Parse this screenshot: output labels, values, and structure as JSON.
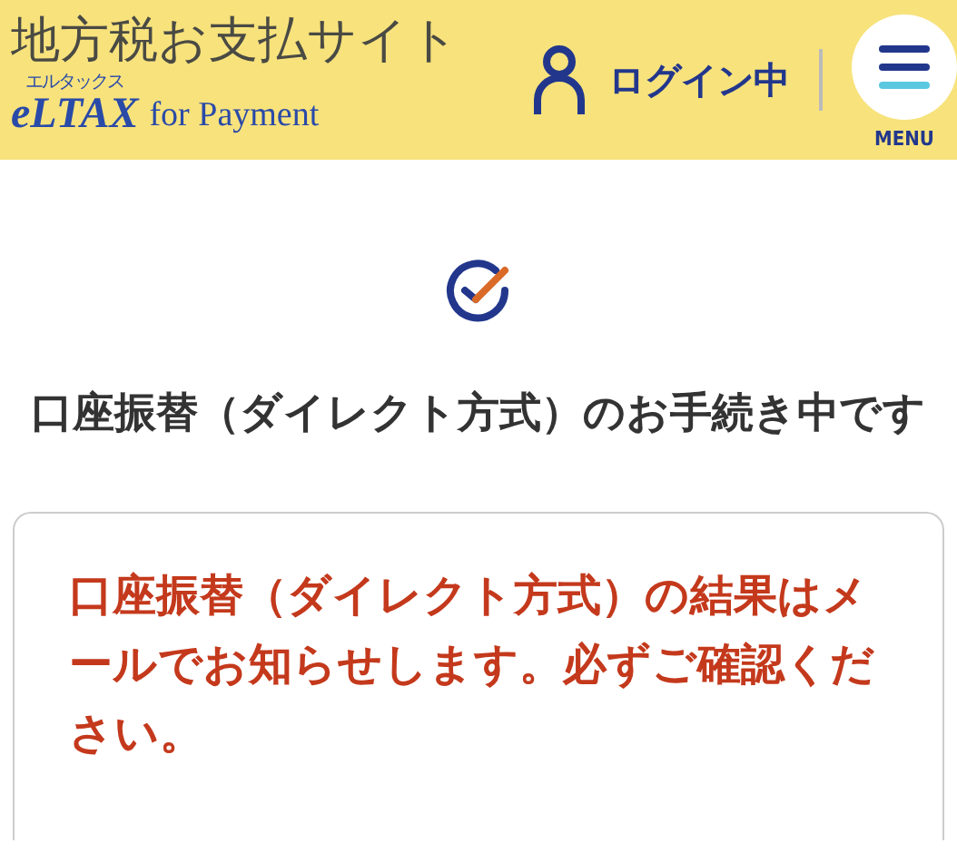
{
  "header": {
    "site_title": "地方税お支払サイト",
    "logo": {
      "ruby": "エルタックス",
      "brand": "eLTAX",
      "tagline": "for Payment"
    },
    "login_status": "ログイン中",
    "menu_label": "MENU"
  },
  "main": {
    "heading": "口座振替（ダイレクト方式）のお手続き中です",
    "notice": "口座振替（ダイレクト方式）の結果はメールでお知らせします。必ずご確認ください。"
  }
}
